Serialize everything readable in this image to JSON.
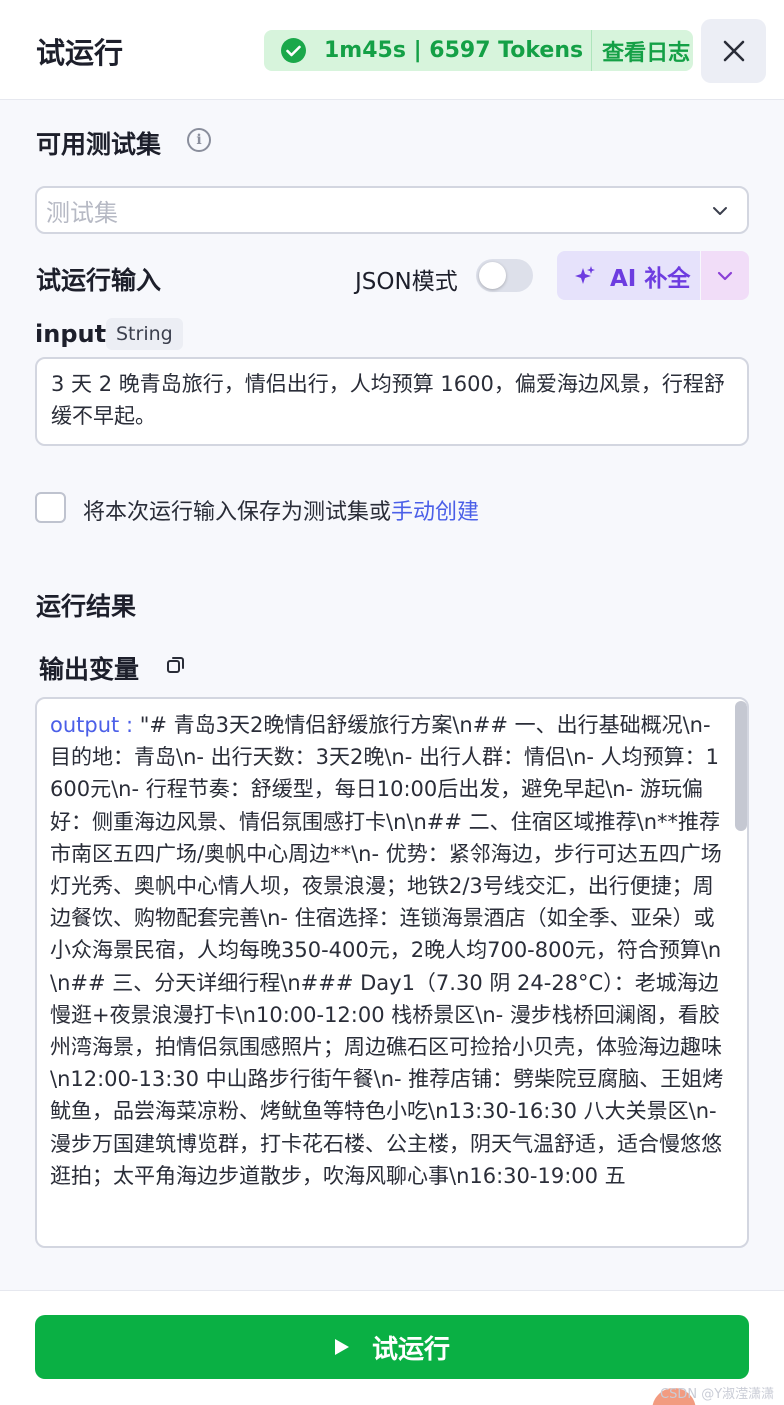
{
  "header": {
    "title": "试运行",
    "status_text": "1m45s | 6597 Tokens",
    "view_log": "查看日志"
  },
  "test_set": {
    "title": "可用测试集",
    "placeholder": "测试集"
  },
  "run_input": {
    "title": "试运行输入",
    "json_mode_label": "JSON模式",
    "ai_fill_label": "AI 补全",
    "field_name": "input",
    "field_type": "String",
    "value": "3 天 2 晚青岛旅行，情侣出行，人均预算 1600，偏爱海边风景，行程舒缓不早起。"
  },
  "save_option": {
    "text": "将本次运行输入保存为测试集或",
    "link": "手动创建"
  },
  "result": {
    "title": "运行结果",
    "output_title": "输出变量",
    "output_key": "output : ",
    "output_value": "\"# 青岛3天2晚情侣舒缓旅行方案\\n## 一、出行基础概况\\n- 目的地：青岛\\n- 出行天数：3天2晚\\n- 出行人群：情侣\\n- 人均预算：1600元\\n- 行程节奏：舒缓型，每日10:00后出发，避免早起\\n- 游玩偏好：侧重海边风景、情侣氛围感打卡\\n\\n## 二、住宿区域推荐\\n**推荐市南区五四广场/奥帆中心周边**\\n- 优势：紧邻海边，步行可达五四广场灯光秀、奥帆中心情人坝，夜景浪漫；地铁2/3号线交汇，出行便捷；周边餐饮、购物配套完善\\n- 住宿选择：连锁海景酒店（如全季、亚朵）或小众海景民宿，人均每晚350-400元，2晚人均700-800元，符合预算\\n\\n## 三、分天详细行程\\n### Day1（7.30 阴 24-28°C）：老城海边慢逛+夜景浪漫打卡\\n10:00-12:00 栈桥景区\\n- 漫步栈桥回澜阁，看胶州湾海景，拍情侣氛围感照片；周边礁石区可捡拾小贝壳，体验海边趣味\\n12:00-13:30 中山路步行街午餐\\n- 推荐店铺：劈柴院豆腐脑、王姐烤鱿鱼，品尝海菜凉粉、烤鱿鱼等特色小吃\\n13:30-16:30 八大关景区\\n- 漫步万国建筑博览群，打卡花石楼、公主楼，阴天气温舒适，适合慢悠悠逛拍；太平角海边步道散步，吹海风聊心事\\n16:30-19:00 五"
  },
  "footer": {
    "run_label": "试运行"
  },
  "watermark": "CSDN @Y淑滢潇潇",
  "colors": {
    "success": "#14a046",
    "accent_purple": "#6d3ce0",
    "link_blue": "#4b5fe8",
    "run_green": "#0ab044"
  }
}
